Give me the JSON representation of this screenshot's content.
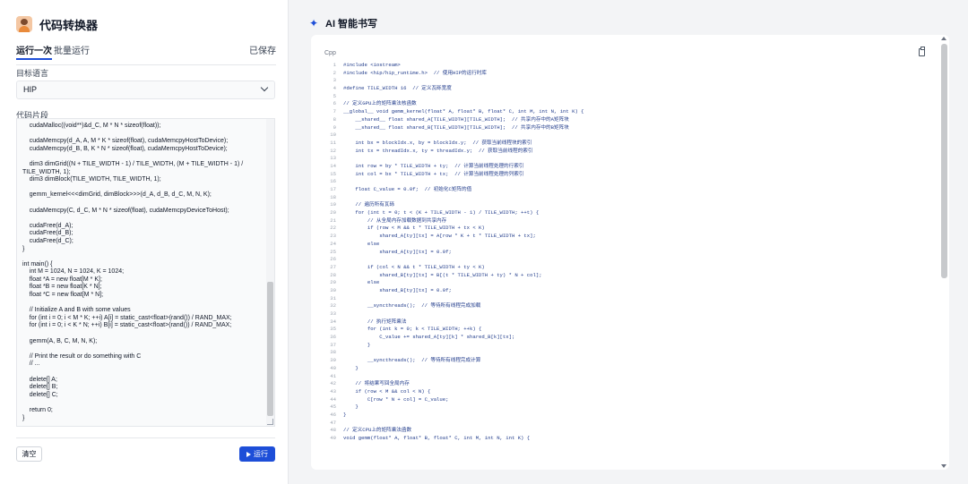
{
  "app": {
    "title": "代码转换器",
    "logo_icon": "avatar-logo-icon"
  },
  "tabs": [
    {
      "label": "运行一次",
      "active": true
    },
    {
      "label": "批量运行",
      "active": false
    }
  ],
  "saved_label": "已保存",
  "target_language": {
    "label": "目标语言",
    "value": "HIP"
  },
  "snippet": {
    "label": "代码片段",
    "source": "    cudaMalloc((void**)&d_C, M * N * sizeof(float));\n\n    cudaMemcpy(d_A, A, M * K * sizeof(float), cudaMemcpyHostToDevice);\n    cudaMemcpy(d_B, B, K * N * sizeof(float), cudaMemcpyHostToDevice);\n\n    dim3 dimGrid((N + TILE_WIDTH - 1) / TILE_WIDTH, (M + TILE_WIDTH - 1) / TILE_WIDTH, 1);\n    dim3 dimBlock(TILE_WIDTH, TILE_WIDTH, 1);\n\n    gemm_kernel<<<dimGrid, dimBlock>>>(d_A, d_B, d_C, M, N, K);\n\n    cudaMemcpy(C, d_C, M * N * sizeof(float), cudaMemcpyDeviceToHost);\n\n    cudaFree(d_A);\n    cudaFree(d_B);\n    cudaFree(d_C);\n}\n\nint main() {\n    int M = 1024, N = 1024, K = 1024;\n    float *A = new float[M * K];\n    float *B = new float[K * N];\n    float *C = new float[M * N];\n\n    // Initialize A and B with some values\n    for (int i = 0; i < M * K; ++i) A[i] = static_cast<float>(rand()) / RAND_MAX;\n    for (int i = 0; i < K * N; ++i) B[i] = static_cast<float>(rand()) / RAND_MAX;\n\n    gemm(A, B, C, M, N, K);\n\n    // Print the result or do something with C\n    // ...\n\n    delete[] A;\n    delete[] B;\n    delete[] C;\n\n    return 0;\n}"
  },
  "buttons": {
    "clear": "清空",
    "run": "运行",
    "run_icon": "play-icon"
  },
  "ai_panel": {
    "icon": "sparkle-icon",
    "title": "AI 智能书写",
    "language": "Cpp",
    "copy_icon": "clipboard-icon",
    "lines": [
      {
        "n": "1",
        "t": "#include <iostream>",
        "k": "pre"
      },
      {
        "n": "2",
        "t": "#include <hip/hip_runtime.h>  // 使用HIP的运行时库",
        "k": "pre"
      },
      {
        "n": "3",
        "t": "",
        "k": ""
      },
      {
        "n": "4",
        "t": "#define TILE_WIDTH 16  // 定义瓦砾宽度",
        "k": "pre"
      },
      {
        "n": "5",
        "t": "",
        "k": ""
      },
      {
        "n": "6",
        "t": "// 定义GPU上的矩阵乘法核函数",
        "k": "cm"
      },
      {
        "n": "7",
        "t": "__global__ void gemm_kernel(float* A, float* B, float* C, int M, int N, int K) {",
        "k": "kw"
      },
      {
        "n": "8",
        "t": "    __shared__ float shared_A[TILE_WIDTH][TILE_WIDTH];  // 共享内存中的A矩阵块",
        "k": "kw"
      },
      {
        "n": "9",
        "t": "    __shared__ float shared_B[TILE_WIDTH][TILE_WIDTH];  // 共享内存中的B矩阵块",
        "k": "kw"
      },
      {
        "n": "10",
        "t": "",
        "k": ""
      },
      {
        "n": "11",
        "t": "    int bx = blockIdx.x, by = blockIdx.y;  // 获取当前线程块的索引",
        "k": "kw"
      },
      {
        "n": "12",
        "t": "    int tx = threadIdx.x, ty = threadIdx.y;  // 获取当前线程的索引",
        "k": "kw"
      },
      {
        "n": "13",
        "t": "",
        "k": ""
      },
      {
        "n": "14",
        "t": "    int row = by * TILE_WIDTH + ty;  // 计算当前线程处理的行索引",
        "k": "kw"
      },
      {
        "n": "15",
        "t": "    int col = bx * TILE_WIDTH + tx;  // 计算当前线程处理的列索引",
        "k": "kw"
      },
      {
        "n": "16",
        "t": "",
        "k": ""
      },
      {
        "n": "17",
        "t": "    float C_value = 0.0f;  // 初始化C矩阵的值",
        "k": "kw"
      },
      {
        "n": "18",
        "t": "",
        "k": ""
      },
      {
        "n": "19",
        "t": "    // 遍历所有瓦砾",
        "k": "cm"
      },
      {
        "n": "20",
        "t": "    for (int t = 0; t < (K + TILE_WIDTH - 1) / TILE_WIDTH; ++t) {",
        "k": "kw"
      },
      {
        "n": "21",
        "t": "        // 从全局内存加载数据到共享内存",
        "k": "cm"
      },
      {
        "n": "22",
        "t": "        if (row < M && t * TILE_WIDTH + tx < K)",
        "k": "kw"
      },
      {
        "n": "23",
        "t": "            shared_A[ty][tx] = A[row * K + t * TILE_WIDTH + tx];",
        "k": ""
      },
      {
        "n": "24",
        "t": "        else",
        "k": "kw"
      },
      {
        "n": "25",
        "t": "            shared_A[ty][tx] = 0.0f;",
        "k": ""
      },
      {
        "n": "26",
        "t": "",
        "k": ""
      },
      {
        "n": "27",
        "t": "        if (col < N && t * TILE_WIDTH + ty < K)",
        "k": "kw"
      },
      {
        "n": "28",
        "t": "            shared_B[ty][tx] = B[(t * TILE_WIDTH + ty) * N + col];",
        "k": ""
      },
      {
        "n": "29",
        "t": "        else",
        "k": "kw"
      },
      {
        "n": "30",
        "t": "            shared_B[ty][tx] = 0.0f;",
        "k": ""
      },
      {
        "n": "31",
        "t": "",
        "k": ""
      },
      {
        "n": "32",
        "t": "        __syncthreads();  // 等待所有线程完成加载",
        "k": ""
      },
      {
        "n": "33",
        "t": "",
        "k": ""
      },
      {
        "n": "34",
        "t": "        // 执行矩阵乘法",
        "k": "cm"
      },
      {
        "n": "35",
        "t": "        for (int k = 0; k < TILE_WIDTH; ++k) {",
        "k": "kw"
      },
      {
        "n": "36",
        "t": "            C_value += shared_A[ty][k] * shared_B[k][tx];",
        "k": ""
      },
      {
        "n": "37",
        "t": "        }",
        "k": ""
      },
      {
        "n": "38",
        "t": "",
        "k": ""
      },
      {
        "n": "39",
        "t": "        __syncthreads();  // 等待所有线程完成计算",
        "k": ""
      },
      {
        "n": "40",
        "t": "    }",
        "k": ""
      },
      {
        "n": "41",
        "t": "",
        "k": ""
      },
      {
        "n": "42",
        "t": "    // 将结果写回全局内存",
        "k": "cm"
      },
      {
        "n": "43",
        "t": "    if (row < M && col < N) {",
        "k": "kw"
      },
      {
        "n": "44",
        "t": "        C[row * N + col] = C_value;",
        "k": ""
      },
      {
        "n": "45",
        "t": "    }",
        "k": ""
      },
      {
        "n": "46",
        "t": "}",
        "k": ""
      },
      {
        "n": "47",
        "t": "",
        "k": ""
      },
      {
        "n": "48",
        "t": "// 定义CPU上的矩阵乘法函数",
        "k": "cm"
      },
      {
        "n": "49",
        "t": "void gemm(float* A, float* B, float* C, int M, int N, int K) {",
        "k": "kw"
      }
    ]
  },
  "colors": {
    "accent": "#1d4ed8",
    "background": "#f3f4f6",
    "panel": "#ffffff"
  }
}
